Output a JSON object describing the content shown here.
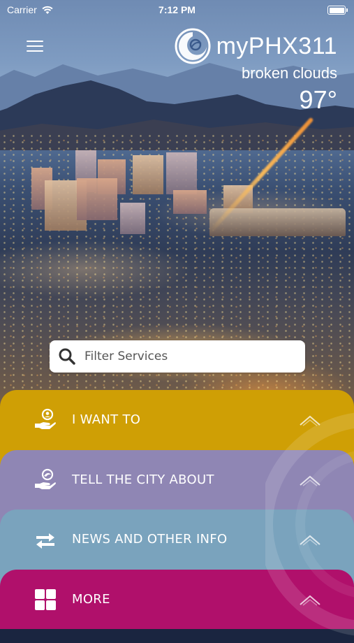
{
  "status_bar": {
    "carrier": "Carrier",
    "time": "7:12 PM"
  },
  "header": {
    "app_name": "myPHX311",
    "menu_icon": "hamburger-menu-icon",
    "logo_icon": "phoenix-logo-icon"
  },
  "weather": {
    "description": "broken clouds",
    "temperature": "97°"
  },
  "search": {
    "placeholder": "Filter Services",
    "value": ""
  },
  "sections": [
    {
      "label": "I WANT TO",
      "icon": "hand-person-icon",
      "color": "#cf9f05"
    },
    {
      "label": "TELL THE CITY ABOUT",
      "icon": "hand-phoenix-icon",
      "color": "#8f86b4"
    },
    {
      "label": "NEWS AND OTHER INFO",
      "icon": "exchange-arrows-icon",
      "color": "#7aa3bd"
    },
    {
      "label": "MORE",
      "icon": "grid-icon",
      "color": "#b0106b"
    }
  ]
}
